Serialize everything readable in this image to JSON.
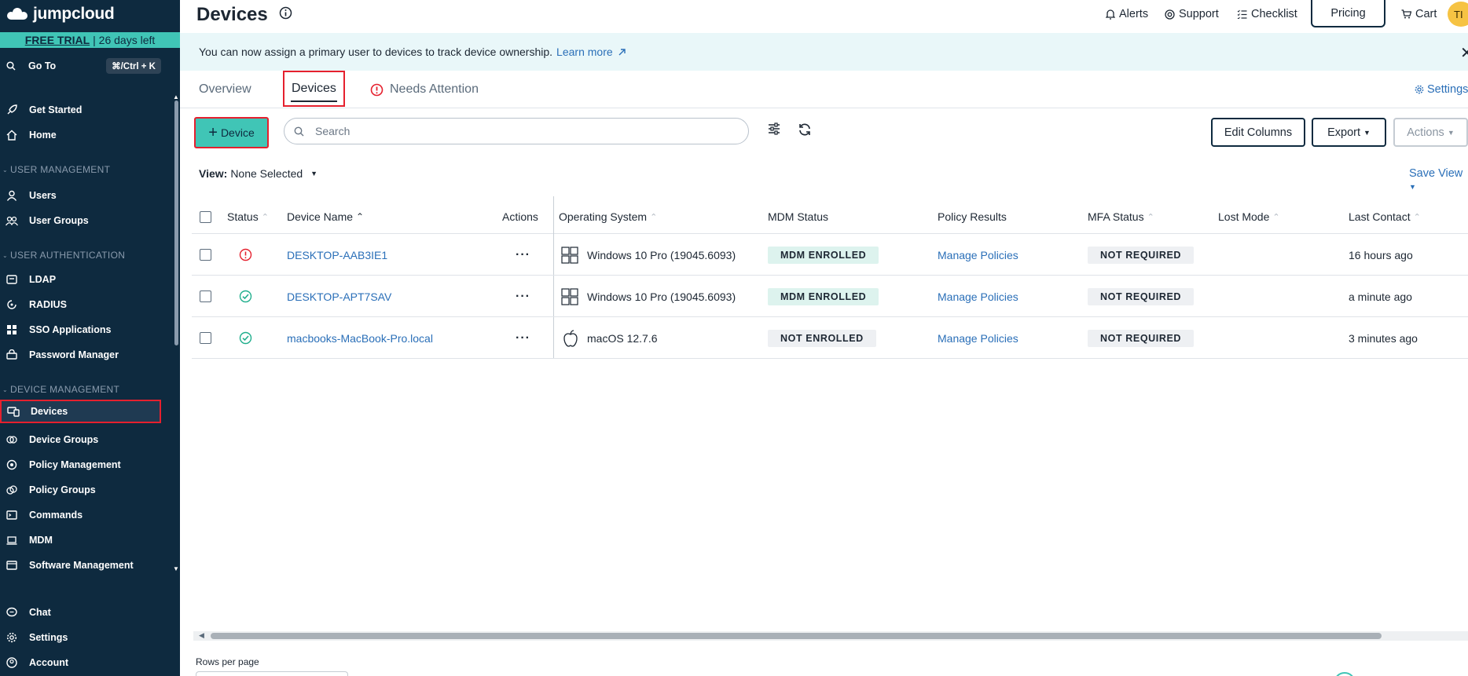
{
  "sidebar": {
    "brand": "jumpcloud",
    "trial": {
      "label": "FREE TRIAL",
      "days": "| 26 days left"
    },
    "goto": {
      "label": "Go To",
      "shortcut": "⌘/Ctrl + K"
    },
    "items_top": [
      {
        "label": "Get Started",
        "icon": "rocket-icon"
      },
      {
        "label": "Home",
        "icon": "home-icon"
      }
    ],
    "sections": {
      "user_mgmt": "USER MANAGEMENT",
      "user_auth": "USER AUTHENTICATION",
      "device_mgmt": "DEVICE MANAGEMENT"
    },
    "user_mgmt_items": [
      {
        "label": "Users"
      },
      {
        "label": "User Groups"
      }
    ],
    "user_auth_items": [
      {
        "label": "LDAP"
      },
      {
        "label": "RADIUS"
      },
      {
        "label": "SSO Applications"
      },
      {
        "label": "Password Manager"
      }
    ],
    "device_mgmt_items": [
      {
        "label": "Devices"
      },
      {
        "label": "Device Groups"
      },
      {
        "label": "Policy Management"
      },
      {
        "label": "Policy Groups"
      },
      {
        "label": "Commands"
      },
      {
        "label": "MDM"
      },
      {
        "label": "Software Management"
      }
    ],
    "bottom_items": [
      {
        "label": "Chat"
      },
      {
        "label": "Settings"
      },
      {
        "label": "Account"
      }
    ]
  },
  "header": {
    "title": "Devices",
    "nav": {
      "alerts": "Alerts",
      "support": "Support",
      "checklist": "Checklist",
      "pricing": "Pricing",
      "cart": "Cart"
    },
    "avatar_initials": "TI"
  },
  "banner": {
    "text": "You can now assign a primary user to devices to track device ownership.",
    "link": "Learn more"
  },
  "tabs": {
    "overview": "Overview",
    "devices": "Devices",
    "needs_attention": "Needs Attention",
    "settings": "Settings"
  },
  "toolbar": {
    "add_device": "Device",
    "search_placeholder": "Search",
    "edit_columns": "Edit Columns",
    "export": "Export",
    "actions": "Actions"
  },
  "view": {
    "label": "View:",
    "value": "None Selected",
    "save_view": "Save View"
  },
  "table": {
    "headers": {
      "status": "Status",
      "device_name": "Device Name",
      "actions": "Actions",
      "os": "Operating System",
      "mdm_status": "MDM Status",
      "policy_results": "Policy Results",
      "mfa_status": "MFA Status",
      "lost_mode": "Lost Mode",
      "last_contact": "Last Contact"
    },
    "rows": [
      {
        "status": "error",
        "name": "DESKTOP-AAB3IE1",
        "os": "Windows 10 Pro (19045.6093)",
        "os_icon": "windows-icon",
        "mdm": "MDM ENROLLED",
        "policy": "Manage Policies",
        "mfa": "NOT REQUIRED",
        "lost_mode": "",
        "last_contact": "16 hours ago"
      },
      {
        "status": "ok",
        "name": "DESKTOP-APT7SAV",
        "os": "Windows 10 Pro (19045.6093)",
        "os_icon": "windows-icon",
        "mdm": "MDM ENROLLED",
        "policy": "Manage Policies",
        "mfa": "NOT REQUIRED",
        "lost_mode": "",
        "last_contact": "a minute ago"
      },
      {
        "status": "ok",
        "name": "macbooks-MacBook-Pro.local",
        "os": "macOS 12.7.6",
        "os_icon": "apple-icon",
        "mdm": "NOT ENROLLED",
        "policy": "Manage Policies",
        "mfa": "NOT REQUIRED",
        "lost_mode": "",
        "last_contact": "3 minutes ago"
      }
    ]
  },
  "footer": {
    "rows_per_page": "Rows per page"
  },
  "colors": {
    "sidebar_bg": "#0e2a3f",
    "accent": "#40c5b6",
    "link": "#2a6fb8",
    "highlight": "#e5202e"
  }
}
